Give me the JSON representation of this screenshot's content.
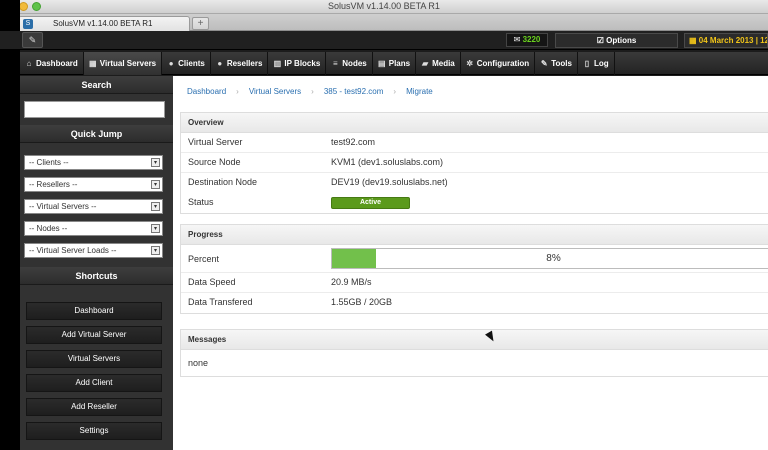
{
  "window": {
    "title": "SolusVM v1.14.00 BETA R1",
    "tab_label": "SolusVM v1.14.00 BETA R1",
    "new_tab": "+"
  },
  "topbar": {
    "message_count": "3220",
    "options_label": "Options",
    "date_text": "04 March 2013 | 12"
  },
  "nav": {
    "items": [
      {
        "label": "Dashboard",
        "icon": "home-icon",
        "glyph": "⌂"
      },
      {
        "label": "Virtual Servers",
        "icon": "grid-icon",
        "glyph": "▦"
      },
      {
        "label": "Clients",
        "icon": "user-icon",
        "glyph": "●"
      },
      {
        "label": "Resellers",
        "icon": "user-icon",
        "glyph": "●"
      },
      {
        "label": "IP Blocks",
        "icon": "ip-icon",
        "glyph": "▥"
      },
      {
        "label": "Nodes",
        "icon": "list-icon",
        "glyph": "≡"
      },
      {
        "label": "Plans",
        "icon": "plan-icon",
        "glyph": "▤"
      },
      {
        "label": "Media",
        "icon": "folder-icon",
        "glyph": "▰"
      },
      {
        "label": "Configuration",
        "icon": "gear-icon",
        "glyph": "✲"
      },
      {
        "label": "Tools",
        "icon": "wrench-icon",
        "glyph": "✎"
      },
      {
        "label": "Log",
        "icon": "document-icon",
        "glyph": "▯"
      }
    ]
  },
  "sidebar": {
    "search_heading": "Search",
    "search_value": "",
    "quick_jump_heading": "Quick Jump",
    "jumps": [
      "-- Clients --",
      "-- Resellers --",
      "-- Virtual Servers --",
      "-- Nodes --",
      "-- Virtual Server Loads --"
    ],
    "shortcuts_heading": "Shortcuts",
    "shortcuts": [
      "Dashboard",
      "Add Virtual Server",
      "Virtual Servers",
      "Add Client",
      "Add Reseller",
      "Settings"
    ]
  },
  "breadcrumb": [
    "Dashboard",
    "Virtual Servers",
    "385 - test92.com",
    "Migrate"
  ],
  "overview": {
    "heading": "Overview",
    "rows": [
      {
        "label": "Virtual Server",
        "value": "test92.com"
      },
      {
        "label": "Source Node",
        "value": "KVM1 (dev1.soluslabs.com)"
      },
      {
        "label": "Destination Node",
        "value": "DEV19 (dev19.soluslabs.net)"
      }
    ],
    "status_label": "Status",
    "status_value": "Active"
  },
  "progress": {
    "heading": "Progress",
    "percent_label": "Percent",
    "percent_text": "8%",
    "percent_value": 0.1,
    "speed_label": "Data Speed",
    "speed_value": "20.9 MB/s",
    "transferred_label": "Data Transfered",
    "transferred_value": "1.55GB / 20GB"
  },
  "messages": {
    "heading": "Messages",
    "text": "none"
  },
  "colors": {
    "progress_fill": "#72c04b",
    "status_active": "#5b9a1c",
    "message_count": "#6ad21e",
    "date": "#f0c419",
    "link": "#2a6fb0"
  }
}
